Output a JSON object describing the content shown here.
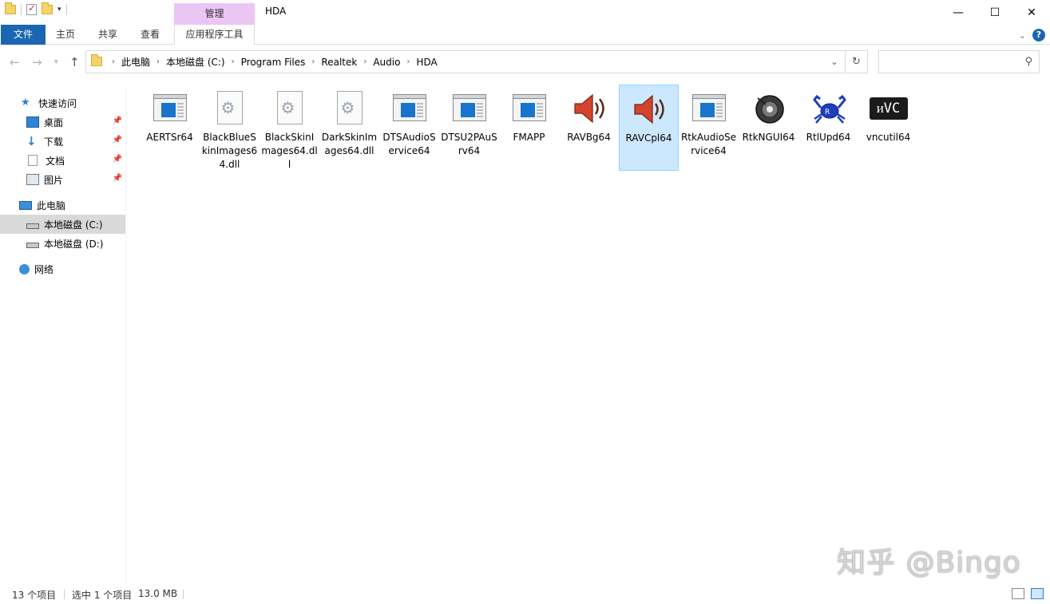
{
  "titlebar": {
    "manage_tab": "管理",
    "title": "HDA",
    "minimize": "—",
    "maximize": "☐",
    "close": "✕"
  },
  "ribbon": {
    "tabs": [
      "文件",
      "主页",
      "共享",
      "查看",
      "应用程序工具"
    ],
    "help": "?"
  },
  "address": {
    "breadcrumbs": [
      "此电脑",
      "本地磁盘 (C:)",
      "Program Files",
      "Realtek",
      "Audio",
      "HDA"
    ],
    "search_placeholder": ""
  },
  "sidebar": {
    "quick_access": "快速访问",
    "items": [
      {
        "label": "桌面",
        "pinned": true
      },
      {
        "label": "下载",
        "pinned": true
      },
      {
        "label": "文档",
        "pinned": true
      },
      {
        "label": "图片",
        "pinned": true
      }
    ],
    "this_pc": "此电脑",
    "drives": [
      {
        "label": "本地磁盘 (C:)",
        "selected": true
      },
      {
        "label": "本地磁盘 (D:)",
        "selected": false
      }
    ],
    "network": "网络"
  },
  "files": [
    {
      "name": "AERTSr64",
      "type": "exe"
    },
    {
      "name": "BlackBlueSkinImages64.dll",
      "type": "dll"
    },
    {
      "name": "BlackSkinImages64.dll",
      "type": "dll"
    },
    {
      "name": "DarkSkinImages64.dll",
      "type": "dll"
    },
    {
      "name": "DTSAudioService64",
      "type": "exe"
    },
    {
      "name": "DTSU2PAuSrv64",
      "type": "exe"
    },
    {
      "name": "FMAPP",
      "type": "exe"
    },
    {
      "name": "RAVBg64",
      "type": "speaker-red"
    },
    {
      "name": "RAVCpl64",
      "type": "speaker-red",
      "selected": true
    },
    {
      "name": "RtkAudioService64",
      "type": "exe"
    },
    {
      "name": "RtkNGUI64",
      "type": "speaker-black"
    },
    {
      "name": "RtlUpd64",
      "type": "crab"
    },
    {
      "name": "vncutil64",
      "type": "vnc"
    }
  ],
  "status": {
    "count": "13 个项目",
    "selected": "选中 1 个项目",
    "size": "13.0 MB"
  },
  "watermark": "知乎 @Bingo",
  "colors": {
    "accent": "#1a66b3",
    "selection": "#cce8ff",
    "manage_tab": "#ebc6f5"
  }
}
